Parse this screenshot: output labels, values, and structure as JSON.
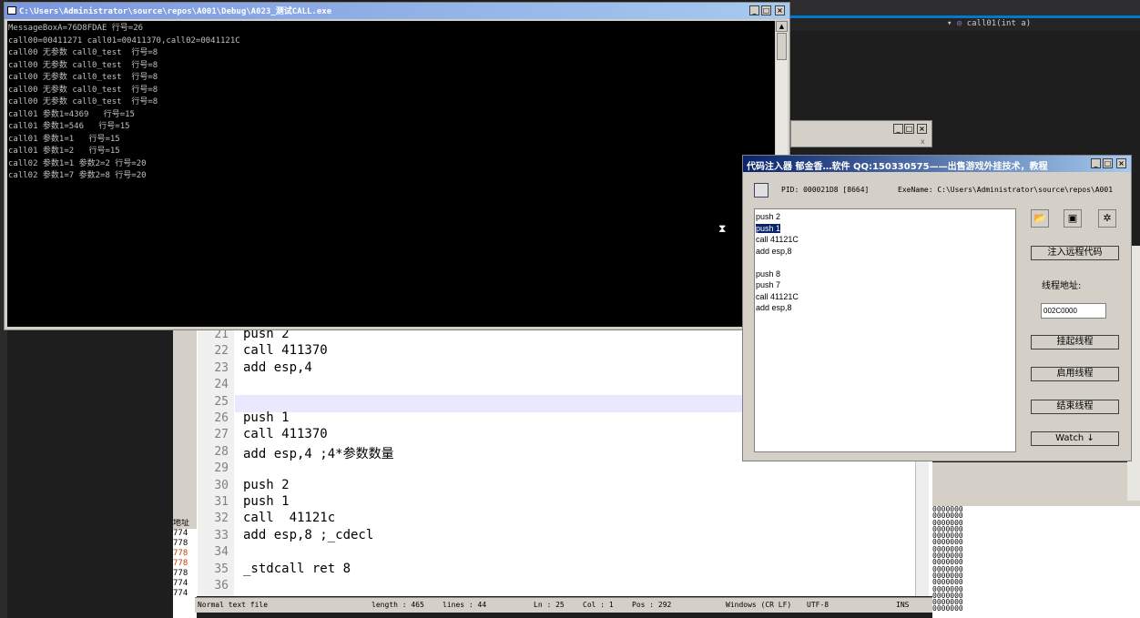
{
  "ide": {
    "nav_combo": "call01(int a)",
    "nav_arrow": "▾",
    "class_icon": "◎"
  },
  "console": {
    "title": "C:\\Users\\Administrator\\source\\repos\\A001\\Debug\\A023_测试CALL.exe",
    "lines": [
      "MessageBoxA=76D8FDAE 行号=26",
      "call00=00411271 call01=00411370,call02=0041121C",
      "call00 无参数 call0_test  行号=8",
      "call00 无参数 call0_test  行号=8",
      "call00 无参数 call0_test  行号=8",
      "call00 无参数 call0_test  行号=8",
      "call00 无参数 call0_test  行号=8",
      "call01 参数1=4369   行号=15",
      "call01 参数1=546   行号=15",
      "call01 参数1=1   行号=15",
      "call01 参数1=2   行号=15",
      "call02 参数1=1 参数2=2 行号=20",
      "call02 参数1=7 参数2=8 行号=20"
    ],
    "buttons": [
      "_",
      "□",
      "×"
    ]
  },
  "bg_window": {
    "buttons": [
      "_",
      "□",
      "×"
    ],
    "mark": "x"
  },
  "editor": {
    "line_numbers": [
      "21",
      "22",
      "23",
      "24",
      "25",
      "26",
      "27",
      "28",
      "29",
      "30",
      "31",
      "32",
      "33",
      "34",
      "35",
      "36"
    ],
    "code_lines": [
      "push 2",
      "call 411370",
      "add esp,4",
      "",
      "",
      "push 1",
      "call 411370",
      "add esp,4 ;4*参数数量",
      "",
      "push 2",
      "push 1",
      "call  41121c",
      "add esp,8 ;_cdecl",
      "",
      "_stdcall ret 8",
      ""
    ],
    "status": {
      "file_type": "Normal text file",
      "length": "length : 465",
      "lines": "lines : 44",
      "ln": "Ln : 25",
      "col": "Col : 1",
      "pos": "Pos : 292",
      "eol": "Windows (CR LF)",
      "encoding": "UTF-8",
      "mode": "INS"
    }
  },
  "memory_panel": {
    "hex_values": [
      "0000000",
      "0000000",
      "0000000",
      "0000000",
      "0000000",
      "0000000",
      "0000000",
      "0000000",
      "0000000",
      "0000000",
      "0000000",
      "0000000",
      "0000000",
      "0000000",
      "0000000",
      "0000000"
    ],
    "left_mini_header": "地址",
    "left_mini_values": [
      "774",
      "778",
      "778",
      "778",
      "778",
      "774",
      "774"
    ]
  },
  "injector": {
    "title": "代码注入器 郁金香…软件 QQ:150330575——出售游戏外挂技术，教程",
    "pid": "PID:  000021D8 [8664]",
    "exe": "ExeName:  C:\\Users\\Administrator\\source\\repos\\A001",
    "code_lines": [
      "push 2",
      "push 1",
      "call 41121C",
      "add esp,8",
      "",
      "push 8",
      "push 7",
      "call 41121C",
      "add esp,8"
    ],
    "selected_index": 1,
    "inject_button": "注入远程代码",
    "thread_addr_label": "线程地址:",
    "thread_addr_value": "002C0000",
    "suspend_button": "挂起线程",
    "resume_button": "启用线程",
    "terminate_button": "结束线程",
    "watch_button": "Watch ↓",
    "buttons": [
      "_",
      "□",
      "×"
    ]
  }
}
